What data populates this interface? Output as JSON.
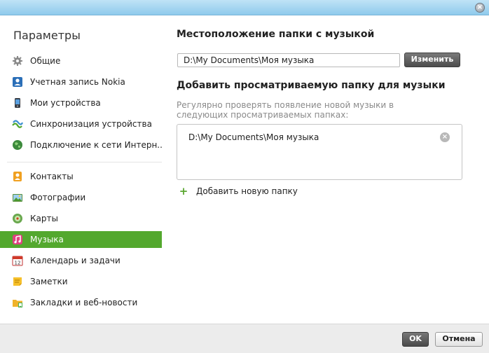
{
  "window": {
    "close_glyph": "×"
  },
  "sidebar": {
    "title": "Параметры",
    "items": [
      {
        "label": "Общие",
        "icon": "gear-icon",
        "active": false
      },
      {
        "label": "Учетная запись Nokia",
        "icon": "user-account-icon",
        "active": false
      },
      {
        "label": "Мои устройства",
        "icon": "phone-icon",
        "active": false
      },
      {
        "label": "Синхронизация устройства",
        "icon": "sync-icon",
        "active": false
      },
      {
        "label": "Подключение к сети Интерн...",
        "icon": "globe-icon",
        "active": false
      },
      {
        "label": "Контакты",
        "icon": "contacts-icon",
        "active": false
      },
      {
        "label": "Фотографии",
        "icon": "photos-icon",
        "active": false
      },
      {
        "label": "Карты",
        "icon": "maps-icon",
        "active": false
      },
      {
        "label": "Музыка",
        "icon": "music-icon",
        "active": true
      },
      {
        "label": "Календарь и задачи",
        "icon": "calendar-icon",
        "active": false
      },
      {
        "label": "Заметки",
        "icon": "notes-icon",
        "active": false
      },
      {
        "label": "Закладки и веб-новости",
        "icon": "bookmarks-icon",
        "active": false
      }
    ]
  },
  "main": {
    "music_folder_title": "Местоположение папки с музыкой",
    "music_folder_path": "D:\\My Documents\\Моя музыка",
    "change_label": "Изменить",
    "watch_title": "Добавить просматриваемую папку для музыки",
    "watch_hint": "Регулярно проверять появление новой музыки в следующих просматриваемых папках:",
    "watched_folders": [
      {
        "path": "D:\\My Documents\\Моя музыка"
      }
    ],
    "remove_glyph": "×",
    "add_folder_glyph": "+",
    "add_folder_label": "Добавить новую папку"
  },
  "footer": {
    "ok_label": "OK",
    "cancel_label": "Отмена"
  },
  "colors": {
    "accent_green": "#53a82e",
    "titlebar_blue": "#8fcaec"
  }
}
